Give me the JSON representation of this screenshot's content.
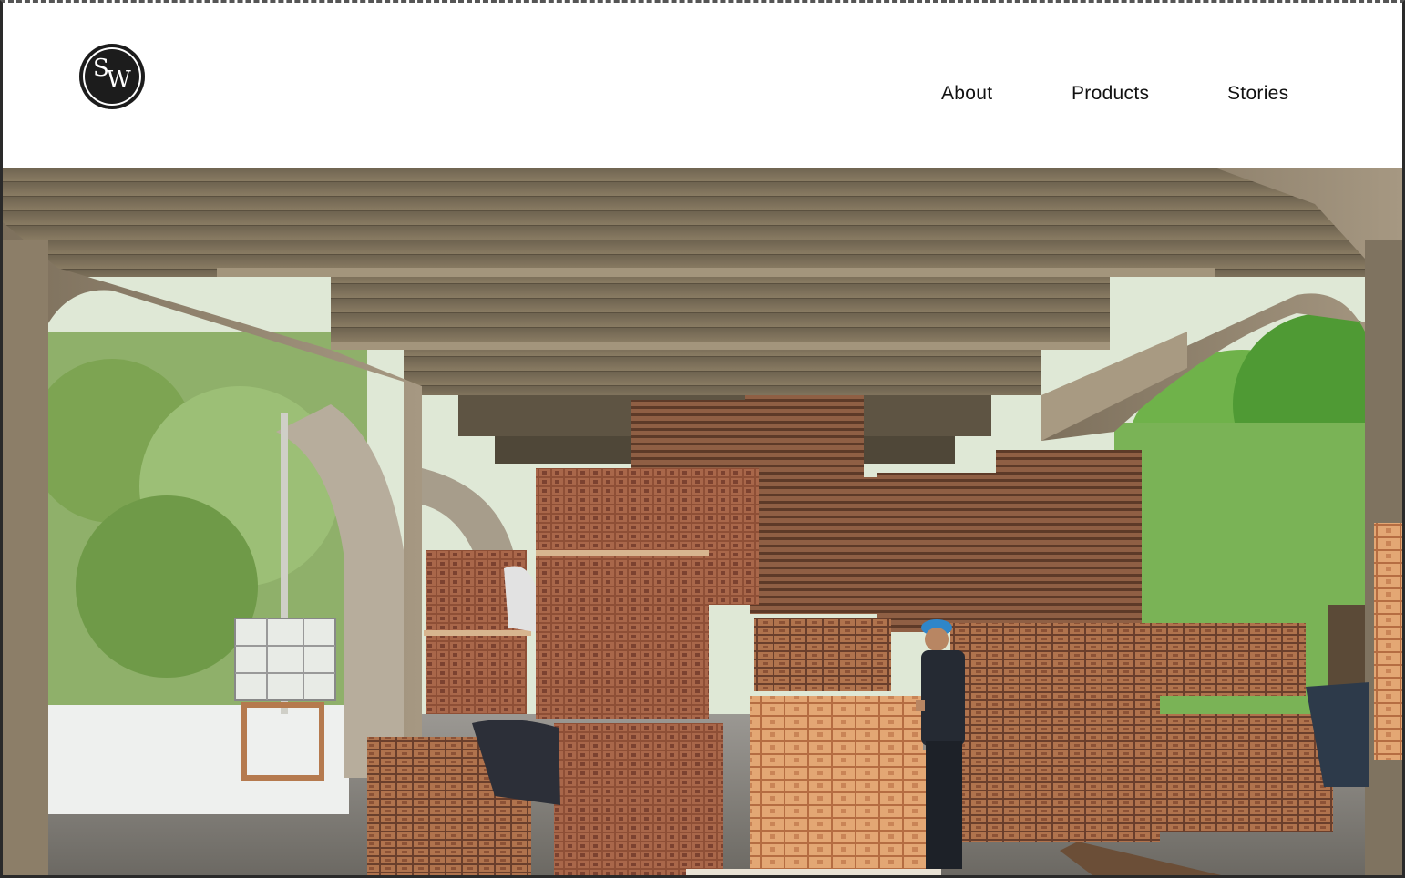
{
  "logo": {
    "letter_s": "S",
    "letter_w": "W"
  },
  "nav": {
    "items": [
      {
        "label": "About"
      },
      {
        "label": "Products"
      },
      {
        "label": "Stories"
      }
    ]
  },
  "hero": {
    "image_subject": "lumber stacks under concrete bridge with worker"
  },
  "colors": {
    "logo_bg": "#1c1c1c",
    "nav_text": "#111111",
    "concrete": "#8a7a62",
    "lumber": "#9a5a3a",
    "foliage": "#6aa84f"
  }
}
